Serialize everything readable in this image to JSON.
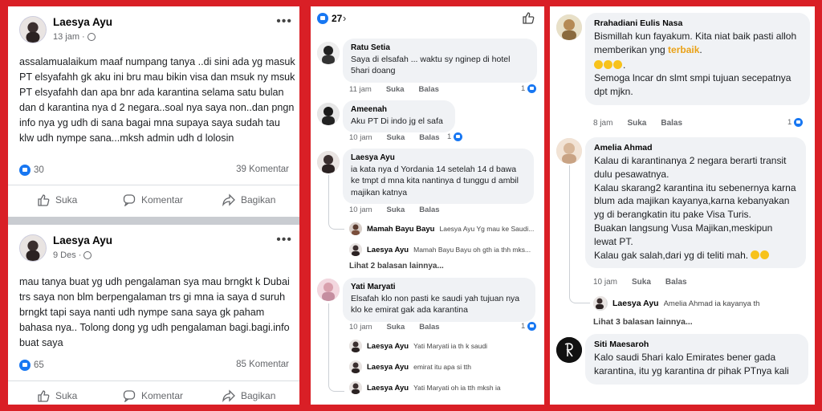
{
  "posts": [
    {
      "author": "Laesya Ayu",
      "time": "13 jam",
      "text": "assalamualaikum maaf numpang tanya ..di sini ada yg masuk PT elsyafahh gk aku ini bru mau bikin visa dan msuk ny msuk PT elsyafahh dan apa bnr ada karantina selama satu bulan dan d karantina nya d 2 negara..soal nya saya non..dan pngn info nya yg udh di sana bagai mna supaya saya sudah tau klw udh nympe sana...mksh admin udh d lolosin",
      "likes": "30",
      "comments": "39 Komentar"
    },
    {
      "author": "Laesya Ayu",
      "time": "9 Des",
      "text": "mau tanya buat yg udh pengalaman sya mau brngkt k Dubai trs saya non blm berpengalaman trs gi mna ia saya d suruh brngkt tapi saya nanti udh nympe sana saya gk paham bahasa nya.. Tolong dong yg udh pengalaman bagi.bagi.info buat saya",
      "likes": "65",
      "comments": "85 Komentar"
    }
  ],
  "actions": {
    "like": "Suka",
    "comment": "Komentar",
    "share": "Bagikan"
  },
  "panel2": {
    "reaction_count": "27",
    "comments": [
      {
        "name": "Ratu Setia",
        "text": "Saya di elsafah ... waktu sy nginep di hotel 5hari doang",
        "time": "11 jam",
        "like": "Suka",
        "reply": "Balas",
        "reactions": "1"
      },
      {
        "name": "Ameenah",
        "text": "Aku PT Di indo jg el safa",
        "time": "10 jam",
        "like": "Suka",
        "reply": "Balas",
        "reactions": "1"
      },
      {
        "name": "Laesya Ayu",
        "text": "ia kata nya d Yordania 14 setelah 14 d bawa ke tmpt d mna kita nantinya d tunggu d ambil majikan katnya",
        "time": "10 jam",
        "like": "Suka",
        "reply": "Balas",
        "reactions": "",
        "replies": [
          {
            "name": "Mamah Bayu Bayu",
            "text": "Laesya Ayu Yg mau ke Saudi..."
          },
          {
            "name": "Laesya Ayu",
            "text": "Mamah Bayu Bayu oh gth ia thh mks..."
          }
        ],
        "more": "Lihat 2 balasan lainnya..."
      },
      {
        "name": "Yati Maryati",
        "text": "Elsafah klo non pasti ke saudi yah tujuan nya klo ke emirat gak ada karantina",
        "time": "10 jam",
        "like": "Suka",
        "reply": "Balas",
        "reactions": "1",
        "replies": [
          {
            "name": "Laesya Ayu",
            "text": "Yati Maryati ia th k saudi"
          },
          {
            "name": "Laesya Ayu",
            "text": "emirat itu apa si tth"
          },
          {
            "name": "Laesya Ayu",
            "text": "Yati Maryati oh ia tth mksh ia"
          }
        ]
      }
    ]
  },
  "panel3": {
    "comments": [
      {
        "name": "Rrahadiani Eulis Nasa",
        "text_before": "Bismillah kun fayakum. Kita niat baik pasti alloh memberikan yng ",
        "highlight": "terbaik",
        "text_after": ".",
        "line2": "Semoga lncar dn slmt smpi tujuan secepatnya dpt mjkn.",
        "time": "8 jam",
        "like": "Suka",
        "reply": "Balas",
        "reactions": "1"
      },
      {
        "name": "Amelia Ahmad",
        "lines": [
          "Kalau di karantinanya 2 negara berarti transit dulu pesawatnya.",
          "Kalau skarang2 karantina itu sebenernya karna blum ada majikan kayanya,karna kebanyakan yg di berangkatin itu pake Visa Turis.",
          "Buakan langsung Vusa Majikan,meskipun lewat PT.",
          "Kalau gak salah,dari yg di teliti mah."
        ],
        "time": "10 jam",
        "like": "Suka",
        "reply": "Balas",
        "replies": [
          {
            "name": "Laesya Ayu",
            "text": "Amelia Ahmad ia kayanya th"
          }
        ],
        "more": "Lihat 3 balasan lainnya..."
      },
      {
        "name": "Siti Maesaroh",
        "text": "Kalo saudi 5hari kalo Emirates bener gada karantina, itu yg karantina dr pihak PTnya kali"
      }
    ]
  },
  "colors": {
    "background": "#d91f26",
    "accent": "#1877f2",
    "bubble": "#f0f2f5",
    "highlight": "#e9a117"
  }
}
